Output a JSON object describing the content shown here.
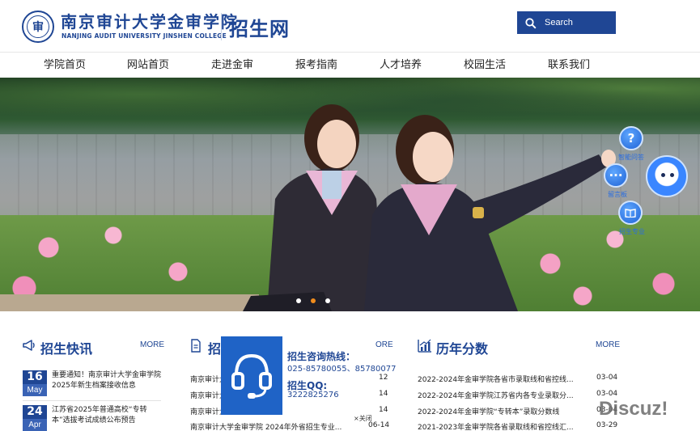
{
  "header": {
    "college_name_cn": "南京审计大学金审学院",
    "college_name_en": "NANJING AUDIT UNIVERSITY JINSHEN COLLEGE",
    "site_name": "招生网",
    "search_placeholder": "Search",
    "brand_color": "#1f4694"
  },
  "nav": {
    "items": [
      {
        "label": "学院首页"
      },
      {
        "label": "网站首页"
      },
      {
        "label": "走进金审"
      },
      {
        "label": "报考指南"
      },
      {
        "label": "人才培养"
      },
      {
        "label": "校园生活"
      },
      {
        "label": "联系我们"
      }
    ]
  },
  "banner": {
    "slide_count": 3,
    "active_slide": 2,
    "tools": [
      {
        "label": "智能问答",
        "icon": "question-icon"
      },
      {
        "label": "留言板",
        "icon": "chat-icon"
      },
      {
        "label": "招生专业",
        "icon": "book-icon"
      }
    ]
  },
  "news": {
    "title": "招生快讯",
    "more": "MORE",
    "items": [
      {
        "day": "16",
        "month": "May",
        "text": "重要通知！南京审计大学金审学院2025年新生档案接收信息"
      },
      {
        "day": "24",
        "month": "Apr",
        "text": "江苏省2025年普通高校“专转本”选拔考试成绩公布预告"
      }
    ]
  },
  "middle": {
    "title": "招",
    "more": "ORE",
    "items": [
      {
        "text": "南京审计大",
        "date": "12"
      },
      {
        "text": "南京审计大",
        "date": "14"
      },
      {
        "text": "南京审计大",
        "date": "14"
      },
      {
        "text": "南京审计大学金审学院 2024年外省招生专业...",
        "date": "06-14"
      }
    ]
  },
  "scores": {
    "title": "历年分数",
    "more": "MORE",
    "items": [
      {
        "text": "2022-2024年金审学院各省市录取线和省控线...",
        "date": "03-04"
      },
      {
        "text": "2022-2024年金审学院江苏省内各专业录取分...",
        "date": "03-04"
      },
      {
        "text": "2022-2024年金审学院“专转本”录取分数线",
        "date": "03-04"
      },
      {
        "text": "2021-2023年金审学院各省录取线和省控线汇...",
        "date": "03-29"
      }
    ]
  },
  "popup": {
    "hotline_label": "招生咨询热线：",
    "hotline_numbers": "025-85780055、85780077",
    "qq_label": "招生QQ:",
    "qq_number": "3222825276",
    "close_label": "×关闭"
  },
  "watermark": "Discuz!"
}
